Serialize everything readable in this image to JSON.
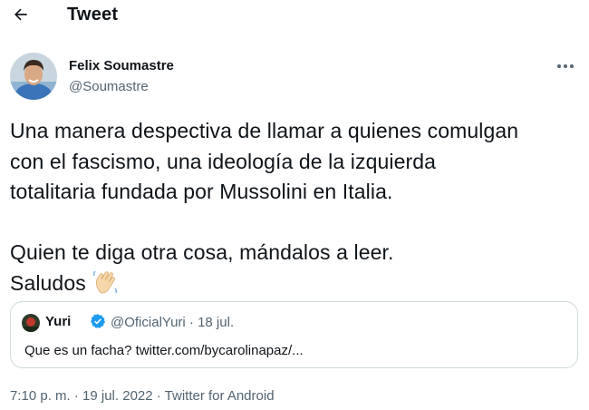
{
  "header": {
    "title": "Tweet",
    "back_icon": "arrow-left-icon"
  },
  "author": {
    "name": "Felix Soumastre",
    "handle": "@Soumastre",
    "more_icon": "more-horizontal-icon"
  },
  "tweet": {
    "text": "Una manera despectiva de llamar a quienes comulgan\ncon el fascismo, una ideología de la izquierda\ntotalitaria fundada por Mussolini en Italia.\n\nQuien te diga otra cosa, mándalos a leer.\nSaludos",
    "emoji": "waving-hand-icon",
    "meta": "7:10 p. m. · 19 jul. 2022 · Twitter for Android"
  },
  "quoted": {
    "name": "Yuri",
    "verified": true,
    "meta": "@OficialYuri · 18 jul.",
    "text": "Que es un facha? twitter.com/bycarolinapaz/..."
  },
  "colors": {
    "text": "#0f1419",
    "secondary": "#536471",
    "border": "#cfd9de",
    "verified": "#1d9bf0"
  }
}
